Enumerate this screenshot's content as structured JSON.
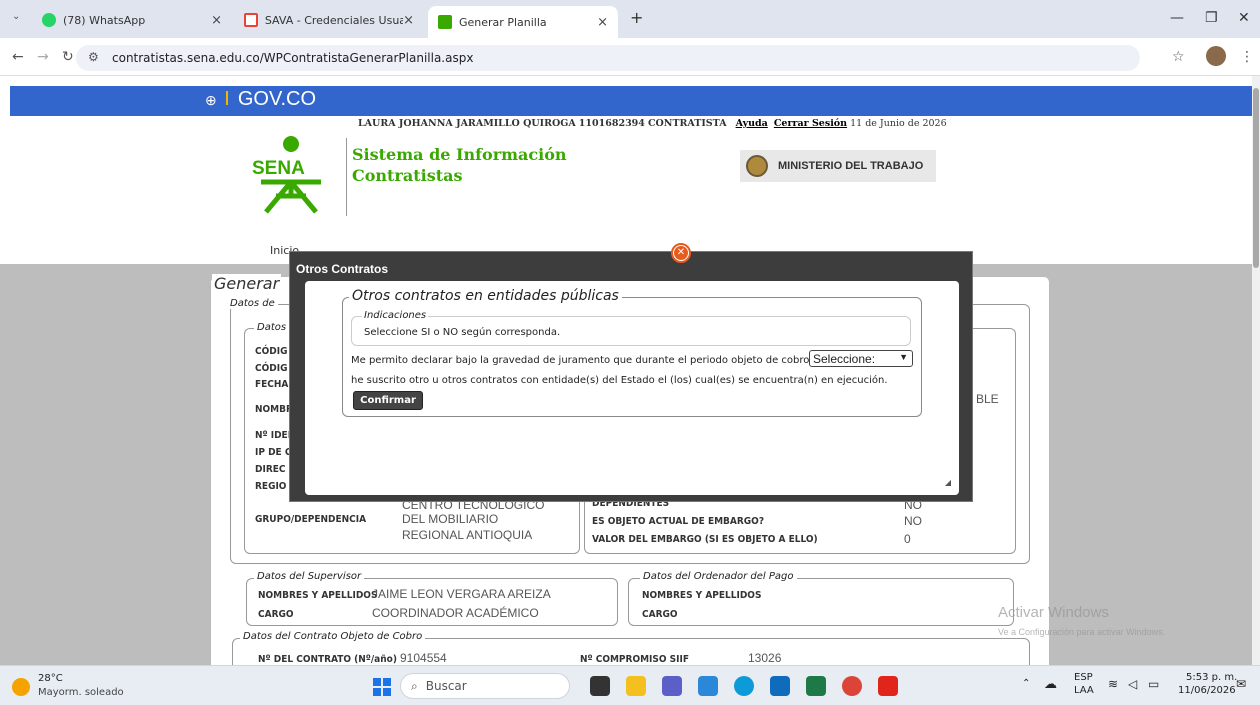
{
  "browser": {
    "tabs": [
      {
        "label": "(78) WhatsApp",
        "active": false,
        "icon": "whatsapp-icon"
      },
      {
        "label": "SAVA - Credenciales Usuario Pl",
        "active": false,
        "icon": "gmail-icon"
      },
      {
        "label": "Generar Planilla",
        "active": true,
        "icon": "sena-icon"
      }
    ],
    "new_tab": "+",
    "url": "contratistas.sena.edu.co/WPContratistaGenerarPlanilla.aspx"
  },
  "header": {
    "gov_logo": "GOV.CO",
    "user_name": "LAURA JOHANNA JARAMILLO QUIROGA",
    "user_id": "1101682394",
    "user_role": "CONTRATISTA",
    "help_link": "Ayuda",
    "logout_link": "Cerrar Sesión",
    "date": "11 de Junio de 2026",
    "sena_text": "SENA",
    "system_title_line1": "Sistema de Información",
    "system_title_line2": "Contratistas",
    "ministry": "MINISTERIO DEL TRABAJO"
  },
  "background_form": {
    "title": "Generar",
    "section_datos": "Datos de",
    "subsection_datos": "Datos",
    "labels": [
      "CÓDIG",
      "CÓDIG",
      "FECHA",
      "NOMBR",
      "Nº IDEN",
      "IP DE C",
      "DIREC",
      "REGIO"
    ],
    "partial_ble": "BLE",
    "centro_line1": "CENTRO TECNOLÓGICO",
    "grupo_label": "GRUPO/DEPENDENCIA",
    "grupo_line1": "DEL MOBILIARIO",
    "grupo_line2": "REGIONAL ANTIOQUIA",
    "dependientes_label": "DEPENDIENTES",
    "dependientes_value": "NO",
    "embargo_label": "ES OBJETO ACTUAL DE EMBARGO?",
    "embargo_value": "NO",
    "valor_embargo_label": "VALOR DEL EMBARGO (SI ES OBJETO A ELLO)",
    "valor_embargo_value": "0",
    "supervisor_legend": "Datos del Supervisor",
    "sup_name_label": "NOMBRES Y APELLIDOS",
    "sup_name_value": "JAIME LEON VERGARA AREIZA",
    "sup_role_label": "CARGO",
    "sup_role_value": "COORDINADOR ACADÉMICO",
    "ordenador_legend": "Datos del Ordenador del Pago",
    "ord_name_label": "NOMBRES Y APELLIDOS",
    "ord_role_label": "CARGO",
    "contrato_legend": "Datos del Contrato Objeto de Cobro",
    "contrato_label": "Nº DEL CONTRATO (Nº/año)",
    "contrato_value": "9104554",
    "compromiso_label": "Nº COMPROMISO SIIF",
    "compromiso_value": "13026"
  },
  "modal": {
    "title": "Otros Contratos",
    "fieldset_legend": "Otros contratos en entidades públicas",
    "indicaciones_legend": "Indicaciones",
    "indicaciones_text": "Seleccione SI o NO según corresponda.",
    "declaration_line1": "Me permito declarar bajo la gravedad de juramento que durante el periodo objeto de cobro",
    "declaration_line2": "he suscrito otro u otros contratos con entidade(s) del Estado el (los) cual(es) se encuentra(n) en ejecución.",
    "select_value": "Seleccione:",
    "confirm_label": "Confirmar"
  },
  "watermark": {
    "line1": "Activar Windows",
    "line2": "Ve a Configuración para activar Windows."
  },
  "taskbar": {
    "temperature": "28°C",
    "weather": "Mayorm. soleado",
    "search_placeholder": "Buscar",
    "lang_line1": "ESP",
    "lang_line2": "LAA",
    "time": "5:53 p. m.",
    "date": "11/06/2026"
  },
  "colors": {
    "gov_blue": "#3366cc",
    "sena_green": "#39a900",
    "modal_dark": "#3d3d3d",
    "close_orange": "#e85b1e"
  }
}
